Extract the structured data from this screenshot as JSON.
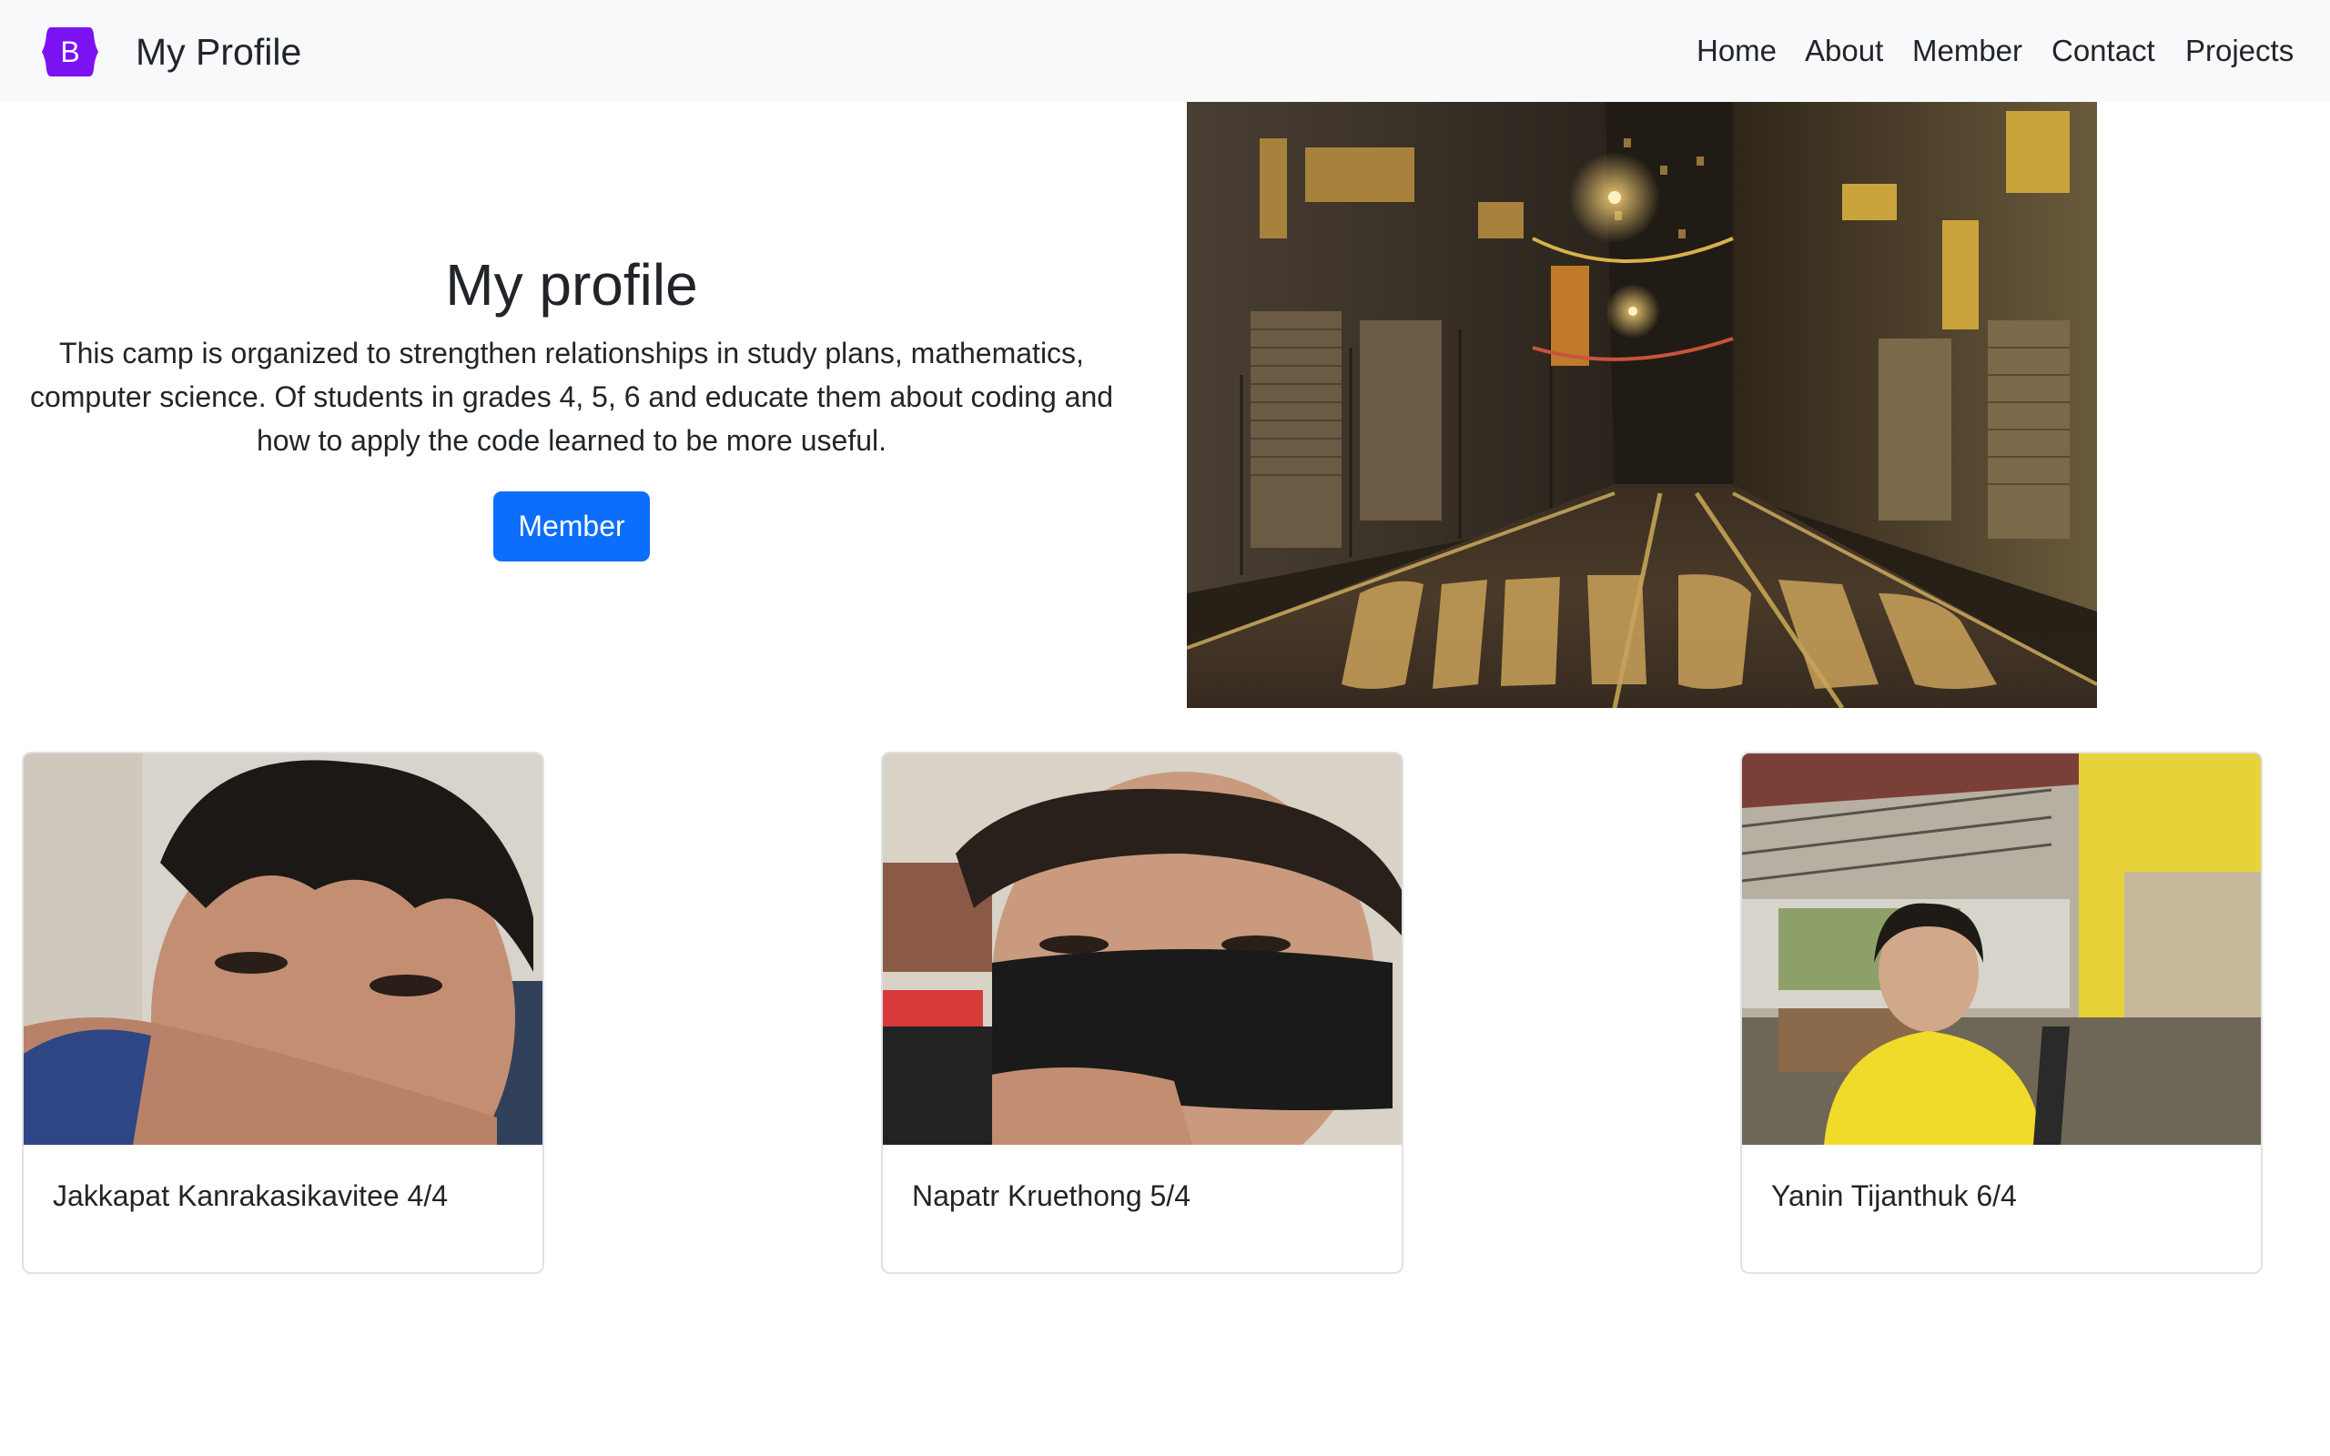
{
  "navbar": {
    "logo_letter": "B",
    "brand": "My Profile",
    "links": [
      "Home",
      "About",
      "Member",
      "Contact",
      "Projects"
    ]
  },
  "hero": {
    "title": "My profile",
    "description": "This camp is organized to strengthen relationships in study plans, mathematics, computer science. Of students in grades 4, 5, 6 and educate them about coding and how to apply the code learned to be more useful.",
    "button_label": "Member"
  },
  "members": [
    {
      "name": "Jakkapat Kanrakasikavitee 4/4"
    },
    {
      "name": "Napatr Kruethong 5/4"
    },
    {
      "name": "Yanin Tijanthuk 6/4"
    }
  ],
  "colors": {
    "navbar_bg": "#f8f9fa",
    "brand_purple": "#7a12f2",
    "button_blue": "#0d6efd",
    "text": "#212529",
    "card_border": "#dfe1e4"
  }
}
